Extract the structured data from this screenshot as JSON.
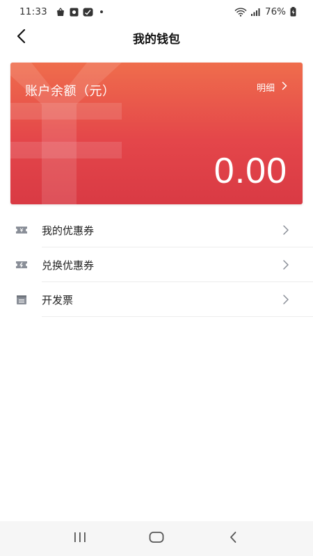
{
  "status_bar": {
    "time": "11:33",
    "battery": "76%",
    "icons": [
      "shopping-bag-icon",
      "camera-square-icon",
      "app-badge-icon",
      "wifi-icon",
      "signal-icon",
      "battery-charging-icon"
    ]
  },
  "header": {
    "title": "我的钱包",
    "back_icon": "chevron-left-icon"
  },
  "balance_card": {
    "label": "账户余额（元）",
    "detail_label": "明细",
    "amount": "0.00",
    "watermark_icon": "yuan-icon",
    "gradient": [
      "#ef6d4c",
      "#e4464a",
      "#d93a44"
    ]
  },
  "menu": {
    "items": [
      {
        "label": "我的优惠券",
        "icon": "coupon-icon"
      },
      {
        "label": "兑换优惠券",
        "icon": "coupon-exchange-icon"
      },
      {
        "label": "开发票",
        "icon": "invoice-icon"
      }
    ]
  },
  "system_nav": {
    "buttons": [
      "recent-apps-icon",
      "home-icon",
      "back-icon"
    ]
  },
  "colors": {
    "accent": "#e4464a",
    "text": "#222222",
    "muted_icon": "#8a8f98",
    "divider": "#ececec"
  }
}
